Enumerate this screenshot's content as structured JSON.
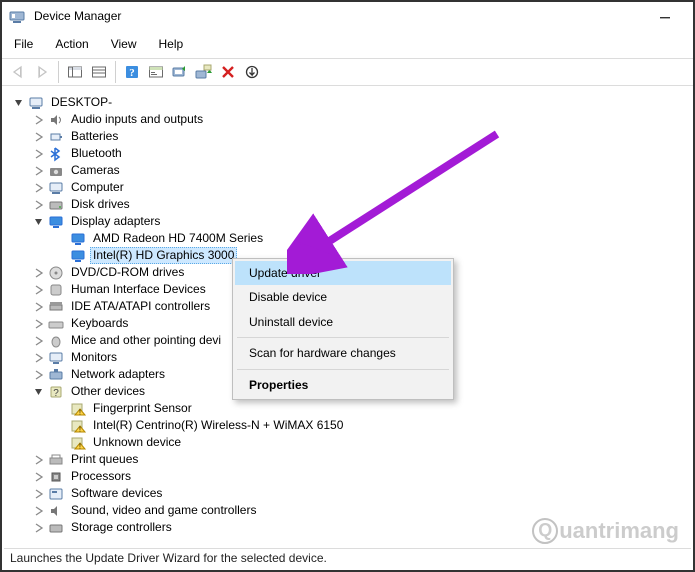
{
  "window": {
    "title": "Device Manager"
  },
  "menu": {
    "file": "File",
    "action": "Action",
    "view": "View",
    "help": "Help"
  },
  "tree": {
    "root": "DESKTOP-",
    "nodes": {
      "audio": "Audio inputs and outputs",
      "batteries": "Batteries",
      "bluetooth": "Bluetooth",
      "cameras": "Cameras",
      "computer": "Computer",
      "disk": "Disk drives",
      "display": "Display adapters",
      "display_amd": "AMD Radeon HD 7400M Series",
      "display_intel": "Intel(R) HD Graphics 3000",
      "dvd": "DVD/CD-ROM drives",
      "hid": "Human Interface Devices",
      "ide": "IDE ATA/ATAPI controllers",
      "keyboards": "Keyboards",
      "mice": "Mice and other pointing devi",
      "monitors": "Monitors",
      "network": "Network adapters",
      "other": "Other devices",
      "other_fp": "Fingerprint Sensor",
      "other_wifi": "Intel(R) Centrino(R) Wireless-N + WiMAX 6150",
      "other_unknown": "Unknown device",
      "printq": "Print queues",
      "proc": "Processors",
      "softdev": "Software devices",
      "svg": "Sound, video and game controllers",
      "storage": "Storage controllers"
    }
  },
  "context": {
    "update": "Update driver",
    "disable": "Disable device",
    "uninstall": "Uninstall device",
    "scan": "Scan for hardware changes",
    "properties": "Properties"
  },
  "status": {
    "text": "Launches the Update Driver Wizard for the selected device."
  },
  "watermark": {
    "text": "uantrimang"
  }
}
